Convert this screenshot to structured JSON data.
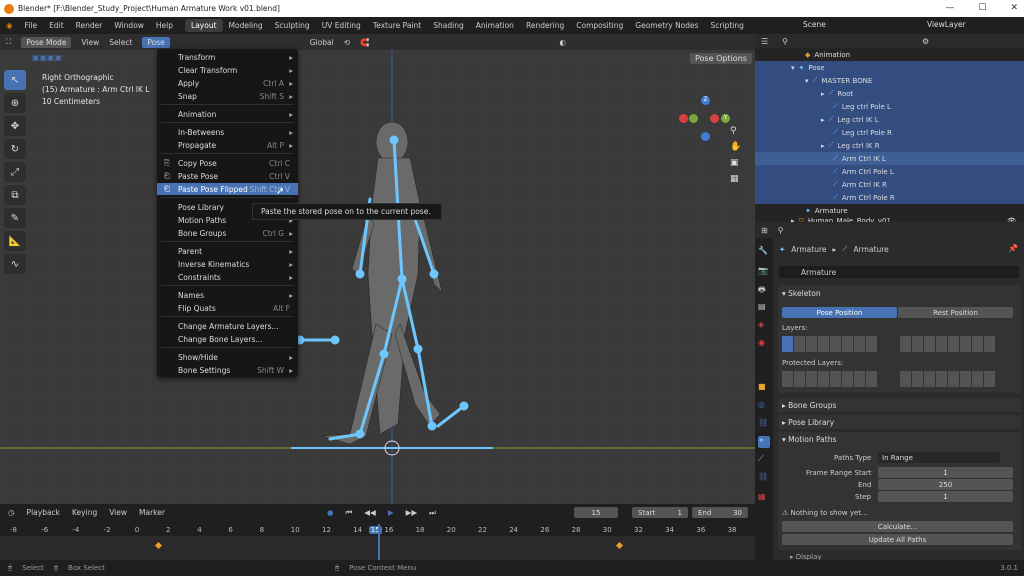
{
  "window": {
    "title": "Blender* [F:\\Blender_Study_Project\\Human Armature Work v01.blend]",
    "ctrl_min": "—",
    "ctrl_max": "☐",
    "ctrl_close": "✕"
  },
  "menubar": {
    "items": [
      "File",
      "Edit",
      "Render",
      "Window",
      "Help"
    ],
    "workspaces": [
      "Layout",
      "Modeling",
      "Sculpting",
      "UV Editing",
      "Texture Paint",
      "Shading",
      "Animation",
      "Rendering",
      "Compositing",
      "Geometry Nodes",
      "Scripting"
    ],
    "scene": "Scene",
    "view_layer": "ViewLayer"
  },
  "viewport": {
    "mode": "Pose Mode",
    "view": "View",
    "select": "Select",
    "pose": "Pose",
    "orientation": "Global",
    "pose_options": "Pose Options",
    "info": [
      "Right Orthographic",
      "(15) Armature : Arm Ctrl IK L",
      "10 Centimeters"
    ]
  },
  "menu": [
    {
      "label": "Transform",
      "arrow": "▸"
    },
    {
      "label": "Clear Transform",
      "arrow": "▸"
    },
    {
      "label": "Apply",
      "shortcut": "Ctrl A",
      "arrow": "▸"
    },
    {
      "label": "Snap",
      "shortcut": "Shift S",
      "arrow": "▸"
    },
    {
      "label": "Animation",
      "arrow": "▸"
    },
    {
      "label": "In-Betweens",
      "arrow": "▸"
    },
    {
      "label": "Propagate",
      "shortcut": "Alt P",
      "arrow": "▸"
    },
    {
      "label": "Copy Pose",
      "shortcut": "Ctrl C"
    },
    {
      "label": "Paste Pose",
      "shortcut": "Ctrl V"
    },
    {
      "label": "Paste Pose Flipped",
      "shortcut": "Shift Ctrl V"
    },
    {
      "label": "Pose Library",
      "arrow": "▸"
    },
    {
      "label": "Motion Paths",
      "arrow": "▸"
    },
    {
      "label": "Bone Groups",
      "shortcut": "Ctrl G",
      "arrow": "▸"
    },
    {
      "label": "Parent",
      "arrow": "▸"
    },
    {
      "label": "Inverse Kinematics",
      "arrow": "▸"
    },
    {
      "label": "Constraints",
      "arrow": "▸"
    },
    {
      "label": "Names",
      "arrow": "▸"
    },
    {
      "label": "Flip Quats",
      "shortcut": "Alt F"
    },
    {
      "label": "Change Armature Layers..."
    },
    {
      "label": "Change Bone Layers..."
    },
    {
      "label": "Show/Hide",
      "arrow": "▸"
    },
    {
      "label": "Bone Settings",
      "shortcut": "Shift W",
      "arrow": "▸"
    }
  ],
  "tooltip": "Paste the stored pose on to the current pose.",
  "timeline": {
    "playback": "Playback",
    "keying": "Keying",
    "view": "View",
    "marker": "Marker",
    "current_frame": "15",
    "start_label": "Start",
    "start": "1",
    "end_label": "End",
    "end": "30",
    "ruler": [
      "-8",
      "-6",
      "-4",
      "-2",
      "0",
      "2",
      "4",
      "6",
      "8",
      "10",
      "12",
      "14",
      "15",
      "16",
      "18",
      "20",
      "22",
      "24",
      "26",
      "28",
      "30",
      "32",
      "34",
      "36",
      "38"
    ]
  },
  "status": {
    "select": "Select",
    "box_select": "Box Select",
    "context": "Pose Context Menu",
    "version": "3.0.1"
  },
  "outliner": {
    "rows": [
      "Animation",
      "Pose",
      "MASTER BONE",
      "Root",
      "Leg ctrl Pole L",
      "Leg ctrl IK L",
      "Leg ctrl Pole R",
      "Leg ctrl IK R",
      "Arm Ctrl IK L",
      "Arm Ctrl Pole L",
      "Arm Ctrl IK R",
      "Arm Ctrl Pole R",
      "Armature",
      "Human_Male_Body_v01"
    ]
  },
  "properties": {
    "breadcrumb_a": "Armature",
    "breadcrumb_b": "Armature",
    "name": "Armature",
    "skeleton": "Skeleton",
    "pose_position": "Pose Position",
    "rest_position": "Rest Position",
    "layers": "Layers:",
    "protected_layers": "Protected Layers:",
    "bone_groups": "Bone Groups",
    "pose_library": "Pose Library",
    "motion_paths": "Motion Paths",
    "paths_type_label": "Paths Type",
    "paths_type": "In Range",
    "frame_range_start_label": "Frame Range Start",
    "frame_range_start": "1",
    "end_label": "End",
    "end": "250",
    "step_label": "Step",
    "step": "1",
    "nothing": "Nothing to show yet...",
    "calculate": "Calculate...",
    "update_all": "Update All Paths",
    "display": "Display"
  },
  "colors": {
    "accent": "#4772b3",
    "bone": "#6ec6ff",
    "orange": "#e87d0d"
  }
}
